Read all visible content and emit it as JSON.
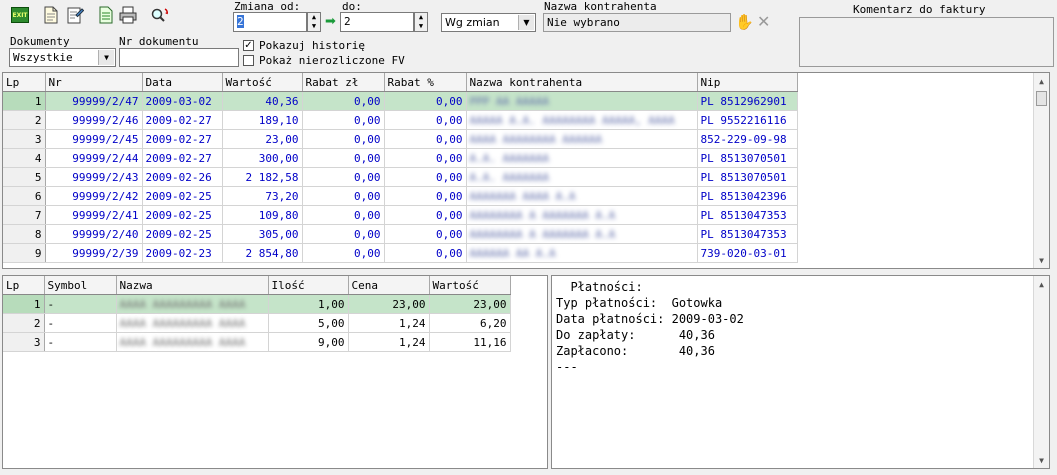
{
  "toolbar": {
    "buttons": [
      {
        "name": "exit-icon",
        "glyph": "EXIT"
      },
      {
        "name": "new-document-icon",
        "glyph": "🗋"
      },
      {
        "name": "edit-document-icon",
        "glyph": "📝"
      },
      {
        "name": "document-list-icon",
        "glyph": "🗎"
      },
      {
        "name": "printer-icon",
        "glyph": "🖶"
      },
      {
        "name": "search-refresh-icon",
        "glyph": "🔍"
      }
    ]
  },
  "filters": {
    "zmiana_od_label": "Zmiana od:",
    "zmiana_od_value": "2",
    "do_label": "do:",
    "do_value": "2",
    "mode_value": "Wg zmian",
    "kontrahent_label": "Nazwa kontrahenta",
    "kontrahent_value": "Nie wybrano",
    "komentarz_label": "Komentarz do faktury",
    "komentarz_value": "",
    "dokumenty_label": "Dokumenty",
    "dokumenty_value": "Wszystkie",
    "nr_dokumentu_label": "Nr dokumentu",
    "nr_dokumentu_value": "",
    "pokazuj_historie_label": "Pokazuj historię",
    "pokazuj_historie_checked": true,
    "nierozliczone_label": "Pokaż nierozliczone FV",
    "nierozliczone_checked": false
  },
  "invoices": {
    "columns": [
      "Lp",
      "Nr",
      "Data",
      "Wartość",
      "Rabat zł",
      "Rabat %",
      "Nazwa kontrahenta",
      "Nip"
    ],
    "rows": [
      {
        "lp": "1",
        "nr": "99999/2/47",
        "data": "2009-03-02",
        "wartosc": "40,36",
        "rabat_zl": "0,00",
        "rabat_pct": "0,00",
        "nazwa": "PPP AA AAAAA",
        "nip": "PL 8512962901",
        "selected": true
      },
      {
        "lp": "2",
        "nr": "99999/2/46",
        "data": "2009-02-27",
        "wartosc": "189,10",
        "rabat_zl": "0,00",
        "rabat_pct": "0,00",
        "nazwa": "AAAAA A.A. AAAAAAAA AAAAA, AAAA",
        "nip": "PL 9552216116",
        "selected": false
      },
      {
        "lp": "3",
        "nr": "99999/2/45",
        "data": "2009-02-27",
        "wartosc": "23,00",
        "rabat_zl": "0,00",
        "rabat_pct": "0,00",
        "nazwa": "AAAA AAAAAAAA AAAAAA",
        "nip": "852-229-09-98",
        "selected": false
      },
      {
        "lp": "4",
        "nr": "99999/2/44",
        "data": "2009-02-27",
        "wartosc": "300,00",
        "rabat_zl": "0,00",
        "rabat_pct": "0,00",
        "nazwa": "A.A. AAAAAAA",
        "nip": "PL 8513070501",
        "selected": false
      },
      {
        "lp": "5",
        "nr": "99999/2/43",
        "data": "2009-02-26",
        "wartosc": "2 182,58",
        "rabat_zl": "0,00",
        "rabat_pct": "0,00",
        "nazwa": "A.A. AAAAAAA",
        "nip": "PL 8513070501",
        "selected": false
      },
      {
        "lp": "6",
        "nr": "99999/2/42",
        "data": "2009-02-25",
        "wartosc": "73,20",
        "rabat_zl": "0,00",
        "rabat_pct": "0,00",
        "nazwa": "AAAAAAA AAAA A.A",
        "nip": "PL 8513042396",
        "selected": false
      },
      {
        "lp": "7",
        "nr": "99999/2/41",
        "data": "2009-02-25",
        "wartosc": "109,80",
        "rabat_zl": "0,00",
        "rabat_pct": "0,00",
        "nazwa": "AAAAAAAA A AAAAAAA A.A",
        "nip": "PL 8513047353",
        "selected": false
      },
      {
        "lp": "8",
        "nr": "99999/2/40",
        "data": "2009-02-25",
        "wartosc": "305,00",
        "rabat_zl": "0,00",
        "rabat_pct": "0,00",
        "nazwa": "AAAAAAAA A AAAAAAA A.A",
        "nip": "PL 8513047353",
        "selected": false
      },
      {
        "lp": "9",
        "nr": "99999/2/39",
        "data": "2009-02-23",
        "wartosc": "2 854,80",
        "rabat_zl": "0,00",
        "rabat_pct": "0,00",
        "nazwa": "AAAAAA AA A.A",
        "nip": "739-020-03-01",
        "selected": false
      }
    ]
  },
  "items": {
    "columns": [
      "Lp",
      "Symbol",
      "Nazwa",
      "Ilość",
      "Cena",
      "Wartość"
    ],
    "rows": [
      {
        "lp": "1",
        "symbol": "-",
        "nazwa": "AAAA AAAAAAAAA AAAA",
        "ilosc": "1,00",
        "cena": "23,00",
        "wartosc": "23,00",
        "selected": true
      },
      {
        "lp": "2",
        "symbol": "-",
        "nazwa": "AAAA AAAAAAAAA AAAA",
        "ilosc": "5,00",
        "cena": "1,24",
        "wartosc": "6,20",
        "selected": false
      },
      {
        "lp": "3",
        "symbol": "-",
        "nazwa": "AAAA AAAAAAAAA AAAA",
        "ilosc": "9,00",
        "cena": "1,24",
        "wartosc": "11,16",
        "selected": false
      }
    ]
  },
  "payment": {
    "title": "  Płatności:",
    "lines": [
      "Typ płatności:  Gotowka",
      "Data płatności: 2009-03-02",
      "Do zapłaty:      40,36",
      "Zapłacono:       40,36",
      "---"
    ]
  },
  "colors": {
    "accent_blue": "#0000c8",
    "selected_row": "#c5e4c9"
  }
}
